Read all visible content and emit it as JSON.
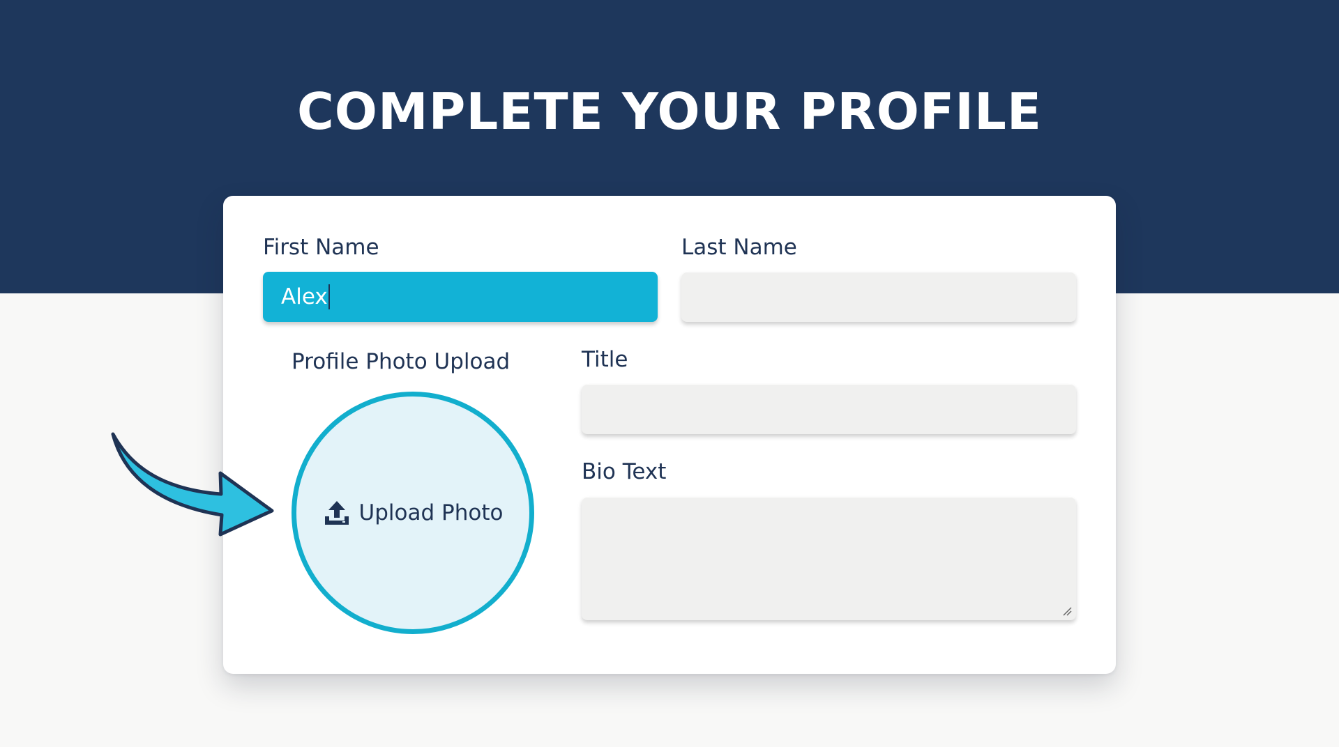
{
  "header": {
    "title": "COMPLETE YOUR PROFILE"
  },
  "form": {
    "first_name": {
      "label": "First Name",
      "value": "Alex"
    },
    "last_name": {
      "label": "Last Name",
      "value": ""
    },
    "photo": {
      "label": "Profile Photo Upload",
      "button_label": "Upload Photo"
    },
    "title": {
      "label": "Title",
      "value": ""
    },
    "bio": {
      "label": "Bio Text",
      "value": ""
    }
  },
  "icons": {
    "upload": "upload-icon",
    "pointer": "arrow-pointer-icon"
  },
  "colors": {
    "header_bg": "#1e375c",
    "accent": "#12b2d6",
    "label_text": "#1f3354",
    "field_bg": "#f0f0ef",
    "upload_bg": "#e3f3f9"
  }
}
